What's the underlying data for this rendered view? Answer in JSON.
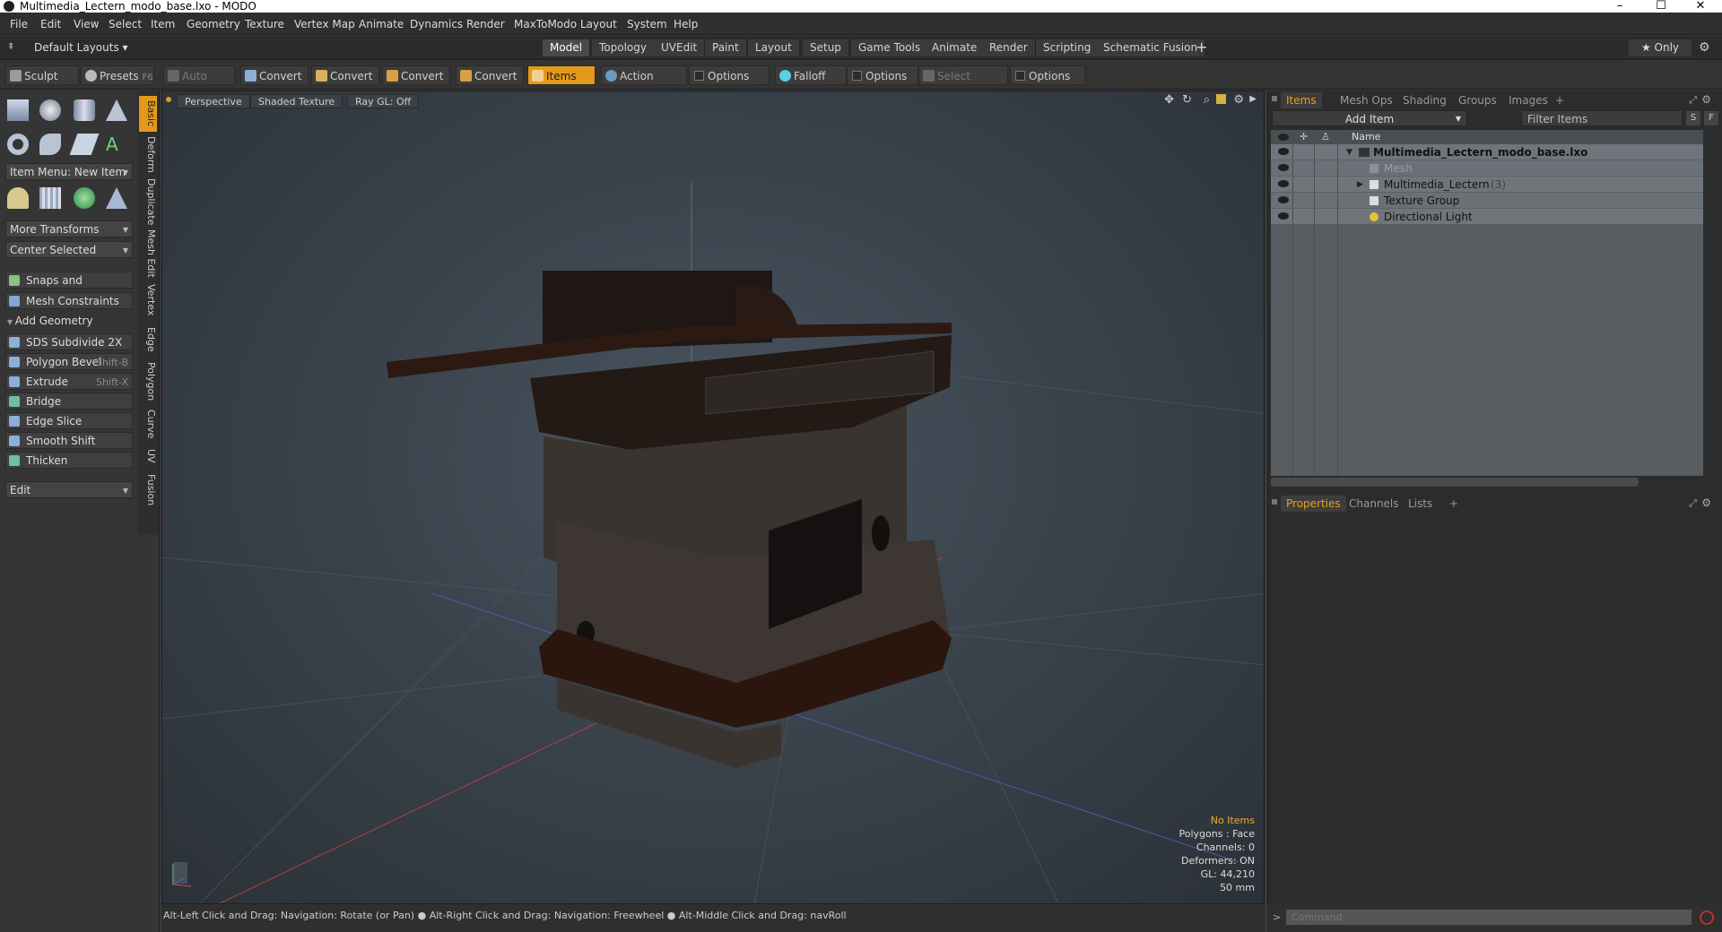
{
  "window": {
    "title": "Multimedia_Lectern_modo_base.lxo - MODO"
  },
  "menu": [
    "File",
    "Edit",
    "View",
    "Select",
    "Item",
    "Geometry",
    "Texture",
    "Vertex Map",
    "Animate",
    "Dynamics",
    "Render",
    "MaxToModo",
    "Layout",
    "System",
    "Help"
  ],
  "layout": {
    "selector": "Default Layouts ▾",
    "tabs": [
      "Model",
      "Topology",
      "UVEdit",
      "Paint",
      "Layout",
      "Setup",
      "Game Tools",
      "Animate",
      "Render",
      "Scripting",
      "Schematic Fusion"
    ],
    "add": "+",
    "only": "★ Only"
  },
  "toolbar": {
    "sculpt": "Sculpt",
    "presets": "Presets",
    "presets_key": "F6",
    "auto_select": "Auto Select",
    "convert1": "Convert",
    "convert2": "Convert",
    "convert3": "Convert",
    "convert4": "Convert",
    "items": "Items",
    "action_center": "Action Center",
    "options1": "Options",
    "falloff": "Falloff",
    "options2": "Options",
    "select_through": "Select Through",
    "options3": "Options"
  },
  "left": {
    "item_menu": "Item Menu: New Item",
    "more_transforms": "More Transforms",
    "center_selected": "Center Selected",
    "snaps": "Snaps and Precision",
    "mesh_constraints": "Mesh Constraints",
    "add_geometry": "Add Geometry",
    "tools": [
      {
        "label": "SDS Subdivide 2X",
        "key": ""
      },
      {
        "label": "Polygon Bevel",
        "key": "Shift-B"
      },
      {
        "label": "Extrude",
        "key": "Shift-X"
      },
      {
        "label": "Bridge",
        "key": ""
      },
      {
        "label": "Edge Slice",
        "key": ""
      },
      {
        "label": "Smooth Shift",
        "key": ""
      },
      {
        "label": "Thicken",
        "key": ""
      }
    ],
    "edit": "Edit"
  },
  "vtabs": [
    "Basic",
    "Deform",
    "Duplicate",
    "Mesh Edit",
    "Vertex",
    "Edge",
    "Polygon",
    "Curve",
    "UV",
    "Fusion"
  ],
  "viewport": {
    "view": "Perspective",
    "shading": "Shaded Texture",
    "raygl": "Ray GL: Off",
    "stats": {
      "items": "No Items",
      "polygons": "Polygons : Face",
      "channels": "Channels: 0",
      "deformers": "Deformers: ON",
      "gl": "GL: 44,210",
      "scale": "50 mm"
    }
  },
  "status": "Alt-Left Click and Drag: Navigation: Rotate (or Pan) ● Alt-Right Click and Drag: Navigation: Freewheel ● Alt-Middle Click and Drag: navRoll",
  "items_panel": {
    "tabs": [
      "Items",
      "Mesh Ops",
      "Shading",
      "Groups",
      "Images"
    ],
    "add": "+",
    "add_item": "Add Item",
    "filter": "Filter Items",
    "s": "S",
    "f": "F",
    "col_name": "Name",
    "tree": [
      {
        "label": "Multimedia_Lectern_modo_base.lxo",
        "count": ""
      },
      {
        "label": "Mesh",
        "count": ""
      },
      {
        "label": "Multimedia_Lectern",
        "count": "(3)"
      },
      {
        "label": "Texture Group",
        "count": ""
      },
      {
        "label": "Directional Light",
        "count": ""
      }
    ]
  },
  "props_panel": {
    "tabs": [
      "Properties",
      "Channels",
      "Lists"
    ],
    "add": "+"
  },
  "command": {
    "placeholder": "Command"
  },
  "colors": {
    "accent": "#e39a1a"
  }
}
